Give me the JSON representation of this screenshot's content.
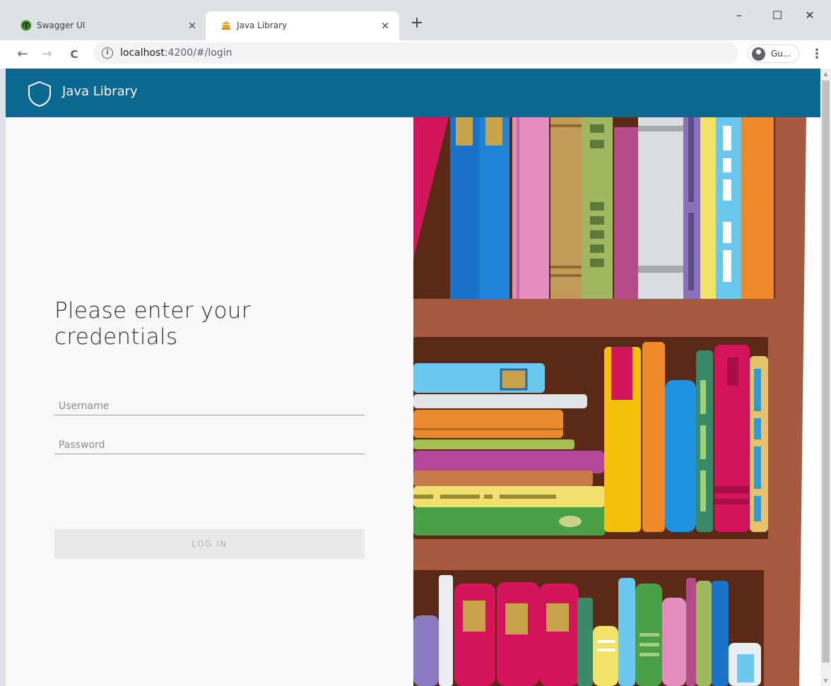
{
  "tabs": [
    {
      "title": "Swagger UI",
      "icon": "swagger-icon",
      "close": "×"
    },
    {
      "title": "Java Library",
      "icon": "library-icon",
      "close": "×"
    }
  ],
  "new_tab": "+",
  "window_controls": {
    "minimize": "–",
    "maximize": "☐",
    "close": "✕"
  },
  "toolbar": {
    "back": "←",
    "forward": "→",
    "reload": "C",
    "url_host": "localhost",
    "url_path": ":4200/#/login",
    "info_icon": "i",
    "profile_name": "Gu...",
    "menu": "⋮"
  },
  "header": {
    "brand": "Java Library",
    "color": "#0a6891"
  },
  "login": {
    "heading": "Please enter your credentials",
    "username_placeholder": "Username",
    "username_value": "",
    "password_placeholder": "Password",
    "password_value": "",
    "submit_label": "LOG IN"
  },
  "scrollbar": {
    "up": "▲",
    "down": "▼"
  }
}
